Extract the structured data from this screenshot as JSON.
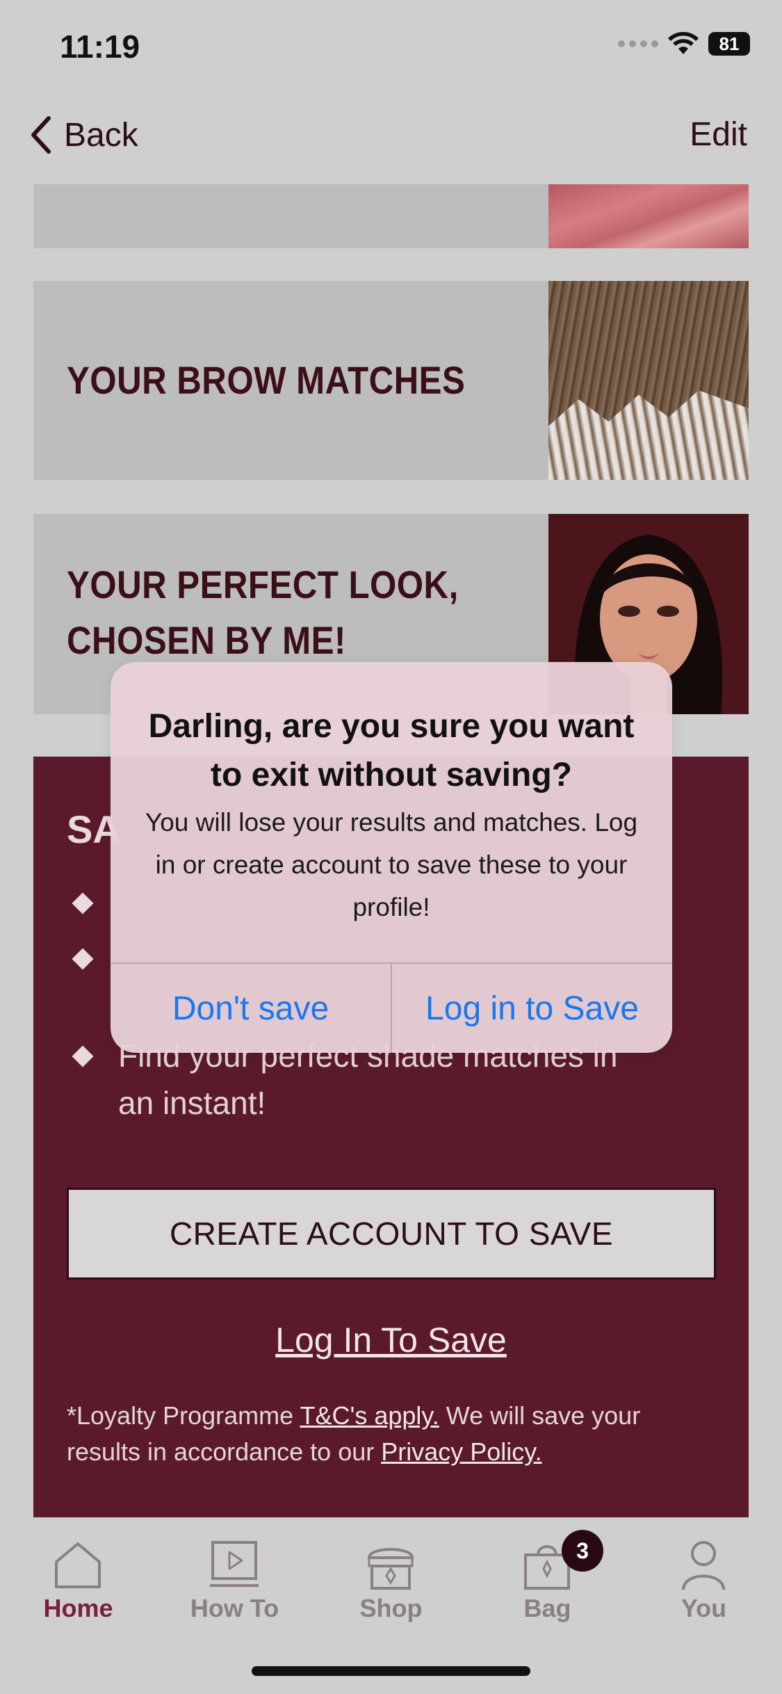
{
  "status_bar": {
    "time": "11:19",
    "battery": "81"
  },
  "nav": {
    "back_label": "Back",
    "edit_label": "Edit"
  },
  "cards": [
    {
      "title": "",
      "thumb": "lipstick-swatch"
    },
    {
      "title": "YOUR BROW MATCHES",
      "thumb": "brow-gel-swatch"
    },
    {
      "title_line1": "YOUR PERFECT LOOK,",
      "title_line2": "CHOSEN BY ME!",
      "thumb": "model-portrait"
    }
  ],
  "save_section": {
    "title_partial": "SA",
    "bullets": [
      {
        "text": ""
      },
      {
        "text": ""
      },
      {
        "text_line1": "Find your perfect shade matches in",
        "text_line2": "an instant!"
      }
    ],
    "create_account_label": "CREATE ACCOUNT TO SAVE",
    "login_link_label": "Log In To Save",
    "legal": {
      "prefix": "*Loyalty Programme ",
      "tc_link": "T&C's apply.",
      "middle": " We will save your results in accordance to our ",
      "privacy_link": "Privacy Policy."
    }
  },
  "alert": {
    "title": "Darling, are you sure you want to exit without saving?",
    "message": "You will lose your results and matches. Log in or create account to save these to your profile!",
    "dont_save_label": "Don't save",
    "login_save_label": "Log in to Save"
  },
  "tabbar": {
    "items": [
      {
        "label": "Home",
        "icon": "home-icon",
        "active": true
      },
      {
        "label": "How To",
        "icon": "play-icon",
        "active": false
      },
      {
        "label": "Shop",
        "icon": "storefront-icon",
        "active": false
      },
      {
        "label": "Bag",
        "icon": "bag-icon",
        "active": false,
        "badge": "3"
      },
      {
        "label": "You",
        "icon": "person-icon",
        "active": false
      }
    ]
  },
  "colors": {
    "accent_maroon": "#5a1a2b",
    "active_tab": "#7a1f3c",
    "ios_blue": "#1778f2"
  }
}
